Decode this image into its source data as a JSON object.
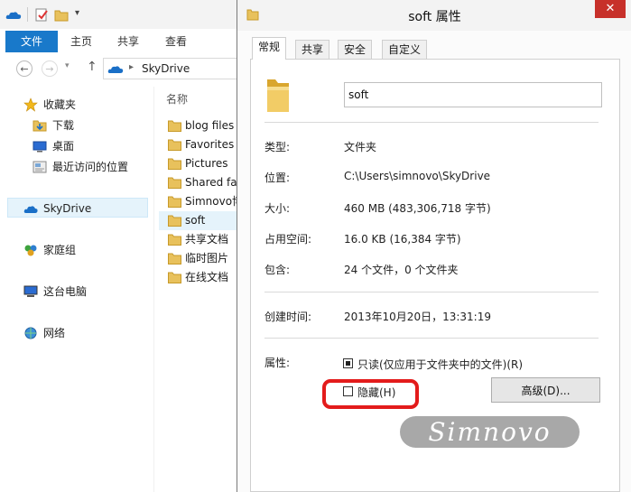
{
  "explorer": {
    "ribbon_tabs": [
      "文件",
      "主页",
      "共享",
      "查看"
    ],
    "address": "SkyDrive",
    "nav": {
      "favorites": "收藏夹",
      "downloads": "下载",
      "desktop": "桌面",
      "recent": "最近访问的位置",
      "skydrive": "SkyDrive",
      "homegroup": "家庭组",
      "this_pc": "这台电脑",
      "network": "网络"
    },
    "column_header": "名称",
    "files": [
      "blog files",
      "Favorites",
      "Pictures",
      "Shared fa",
      "Simnovo博",
      "soft",
      "共享文档",
      "临时图片",
      "在线文档"
    ],
    "selected_file_index": 5
  },
  "dialog": {
    "title": "soft 属性",
    "close_glyph": "✕",
    "tabs": [
      "常规",
      "共享",
      "安全",
      "自定义"
    ],
    "folder_name": "soft",
    "props": {
      "type_label": "类型:",
      "type_value": "文件夹",
      "location_label": "位置:",
      "location_value": "C:\\Users\\simnovo\\SkyDrive",
      "size_label": "大小:",
      "size_value": "460 MB (483,306,718 字节)",
      "disk_label": "占用空间:",
      "disk_value": "16.0 KB (16,384 字节)",
      "contains_label": "包含:",
      "contains_value": "24 个文件，0 个文件夹",
      "created_label": "创建时间:",
      "created_value": "2013年10月20日，13:31:19",
      "attrs_label": "属性:",
      "readonly_label": "只读(仅应用于文件夹中的文件)(R)",
      "hidden_label": "隐藏(H)",
      "advanced_label": "高级(D)..."
    },
    "readonly_checked": "indeterminate",
    "hidden_checked": false
  },
  "watermark": "Simnovo",
  "colors": {
    "ribbon_file": "#1979ca",
    "close": "#c7302a",
    "highlight": "#e31b1b"
  }
}
